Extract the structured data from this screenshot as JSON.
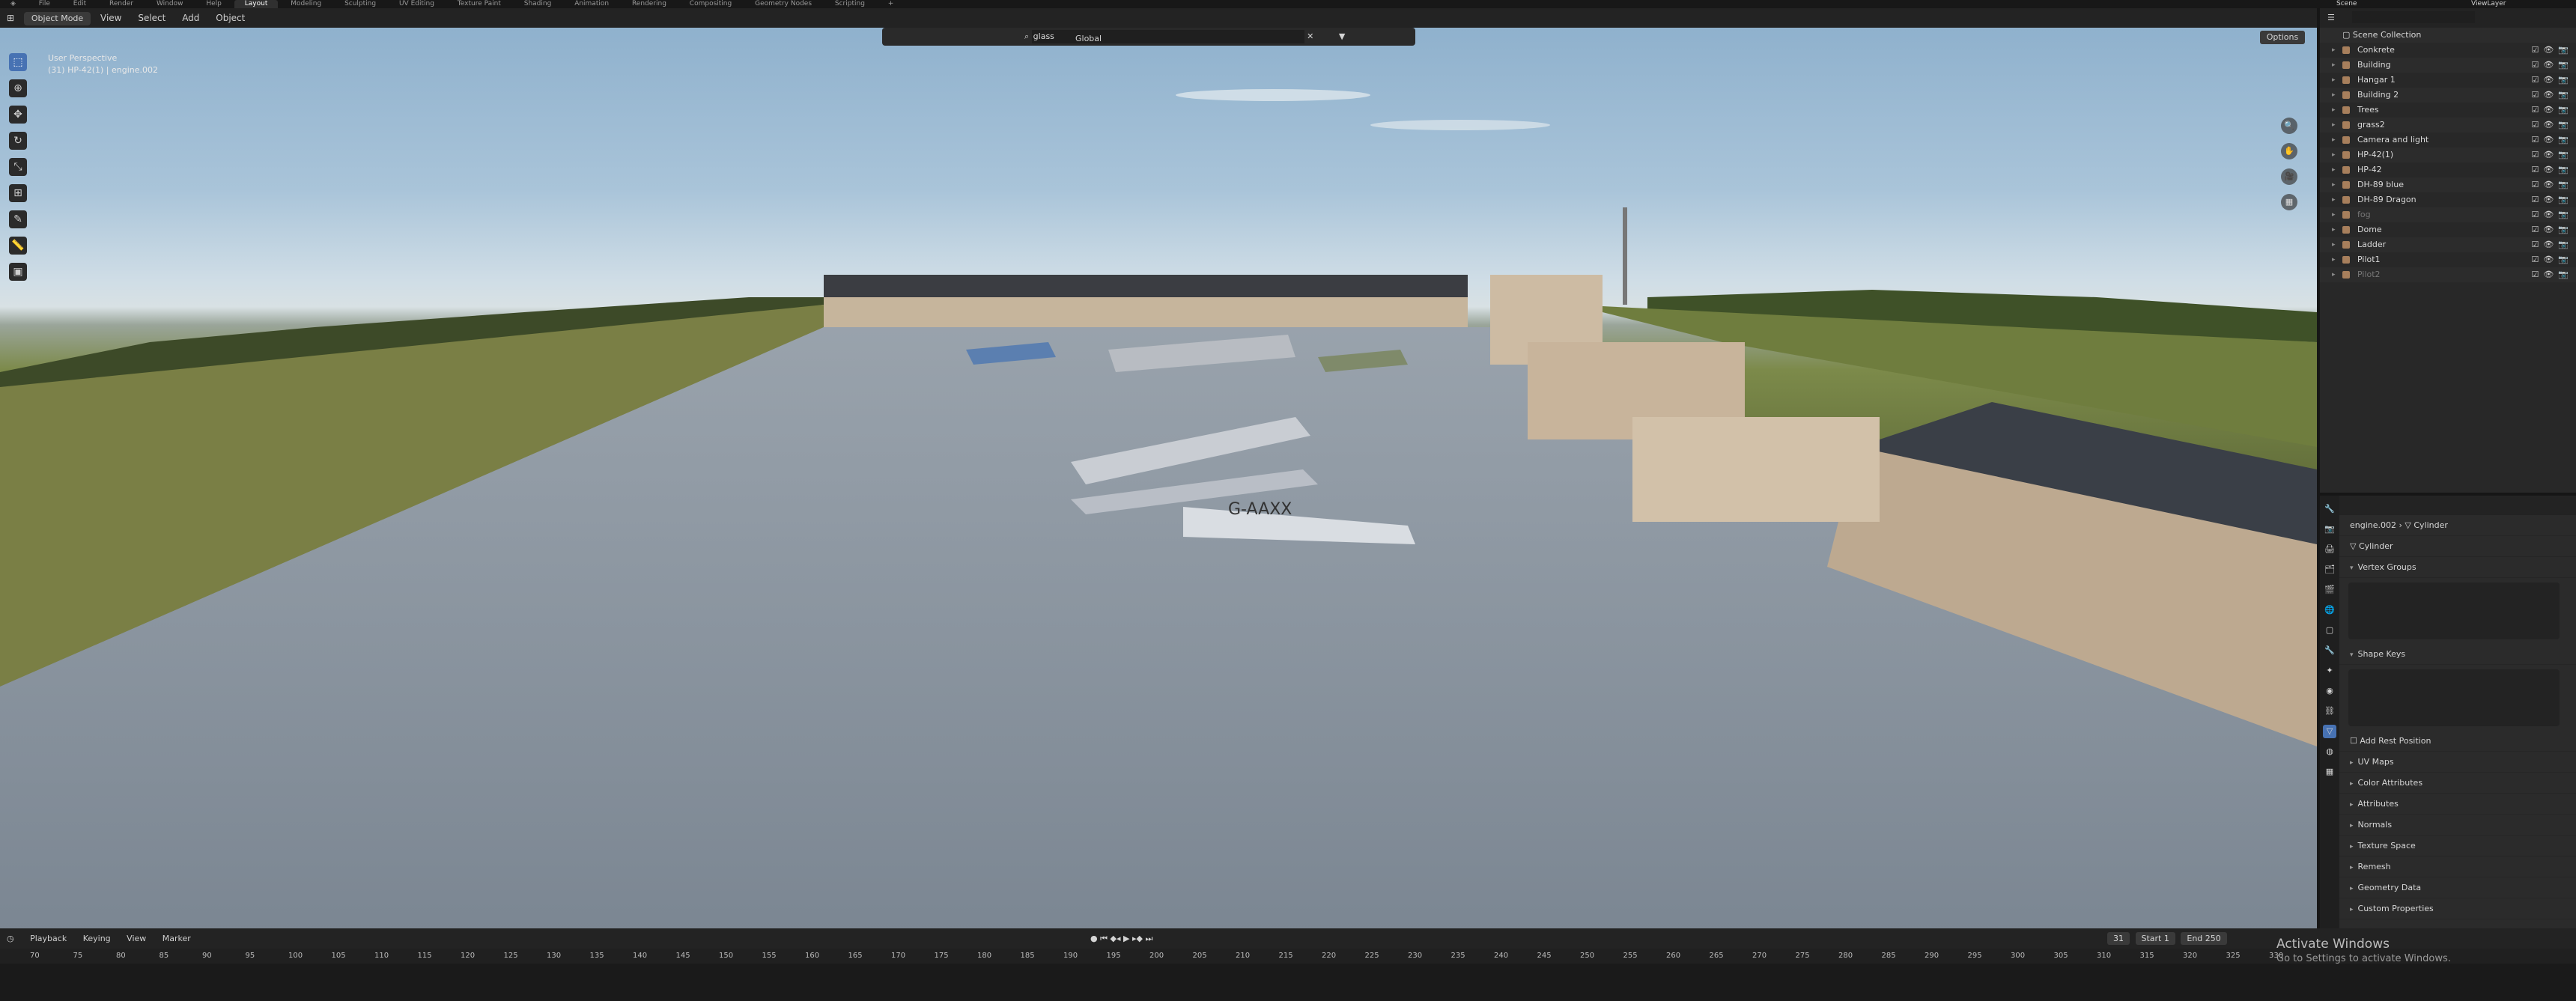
{
  "topbar": {
    "menus": [
      "File",
      "Edit",
      "Render",
      "Window",
      "Help"
    ],
    "workspaces": [
      "Layout",
      "Modeling",
      "Sculpting",
      "UV Editing",
      "Texture Paint",
      "Shading",
      "Animation",
      "Rendering",
      "Compositing",
      "Geometry Nodes",
      "Scripting"
    ],
    "active_workspace": "Layout",
    "scene_name": "Scene",
    "view_layer_name": "ViewLayer"
  },
  "header": {
    "mode": "Object Mode",
    "menus": [
      "View",
      "Select",
      "Add",
      "Object"
    ],
    "orientation": "Global",
    "options": "Options"
  },
  "viewport": {
    "perspective": "User Perspective",
    "object_info": "(31) HP-42(1) | engine.002",
    "search_value": "glass",
    "plane_tail": "G-AAXX"
  },
  "outliner": {
    "search_placeholder": "",
    "root": "Scene Collection",
    "items": [
      {
        "name": "Conkrete",
        "dim": false
      },
      {
        "name": "Building",
        "dim": false
      },
      {
        "name": "Hangar 1",
        "dim": false
      },
      {
        "name": "Building 2",
        "dim": false
      },
      {
        "name": "Trees",
        "dim": false
      },
      {
        "name": "grass2",
        "dim": false
      },
      {
        "name": "Camera and light",
        "dim": false
      },
      {
        "name": "HP-42(1)",
        "dim": false
      },
      {
        "name": "HP-42",
        "dim": false
      },
      {
        "name": "DH-89 blue",
        "dim": false
      },
      {
        "name": "DH-89 Dragon",
        "dim": false
      },
      {
        "name": "fog",
        "dim": true
      },
      {
        "name": "Dome",
        "dim": false
      },
      {
        "name": "Ladder",
        "dim": false
      },
      {
        "name": "Pilot1",
        "dim": false
      },
      {
        "name": "Pilot2",
        "dim": true
      }
    ]
  },
  "properties": {
    "breadcrumb_object": "engine.002",
    "breadcrumb_mesh": "Cylinder",
    "datablock_name": "Cylinder",
    "sections": {
      "vertex_groups": "Vertex Groups",
      "shape_keys": "Shape Keys",
      "add_rest_position": "Add Rest Position",
      "uv_maps": "UV Maps",
      "color_attributes": "Color Attributes",
      "attributes": "Attributes",
      "normals": "Normals",
      "texture_space": "Texture Space",
      "remesh": "Remesh",
      "geometry_data": "Geometry Data",
      "custom_properties": "Custom Properties"
    }
  },
  "timeline": {
    "menus": [
      "Playback",
      "Keying",
      "View",
      "Marker"
    ],
    "current_frame": "31",
    "start_label": "Start",
    "start_value": "1",
    "end_label": "End",
    "end_value": "250",
    "ruler_ticks": [
      "70",
      "75",
      "80",
      "85",
      "90",
      "95",
      "100",
      "105",
      "110",
      "115",
      "120",
      "125",
      "130",
      "135",
      "140",
      "145",
      "150",
      "155",
      "160",
      "165",
      "170",
      "175",
      "180",
      "185",
      "190",
      "195",
      "200",
      "205",
      "210",
      "215",
      "220",
      "225",
      "230",
      "235",
      "240",
      "245",
      "250",
      "255",
      "260",
      "265",
      "270",
      "275",
      "280",
      "285",
      "290",
      "295",
      "300",
      "305",
      "310",
      "315",
      "320",
      "325",
      "330"
    ]
  },
  "watermark": {
    "title": "Activate Windows",
    "subtitle": "Go to Settings to activate Windows."
  },
  "colors": {
    "accent": "#4772b3",
    "outliner_icon": "#a77f5c",
    "background": "#1d1d1d"
  }
}
